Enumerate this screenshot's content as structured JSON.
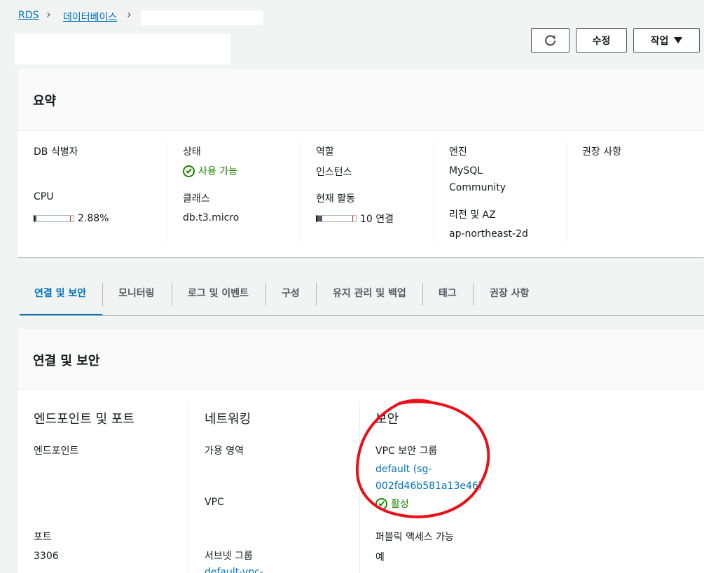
{
  "breadcrumb": {
    "rds": "RDS",
    "databases": "데이터베이스",
    "separator": "›"
  },
  "actions": {
    "refresh_icon": "refresh-icon",
    "modify": "수정",
    "actions": "작업",
    "dropdown_icon": "caret-down-icon"
  },
  "summary": {
    "title": "요약",
    "db_identifier_label": "DB 식별자",
    "cpu_label": "CPU",
    "cpu_value": "2.88%",
    "cpu_fraction": 0.0288,
    "status_label": "상태",
    "status_value": "사용 가능",
    "class_label": "클래스",
    "class_value": "db.t3.micro",
    "role_label": "역할",
    "role_value": "인스턴스",
    "activity_label": "현재 활동",
    "activity_value": "10 연결",
    "activity_fraction": 0.12,
    "engine_label": "엔진",
    "engine_value_line1": "MySQL",
    "engine_value_line2": "Community",
    "region_label": "리전 및 AZ",
    "region_value": "ap-northeast-2d",
    "recommendations_label": "권장 사항"
  },
  "tabs": [
    {
      "label": "연결 및 보안"
    },
    {
      "label": "모니터링"
    },
    {
      "label": "로그 및 이벤트"
    },
    {
      "label": "구성"
    },
    {
      "label": "유지 관리 및 백업"
    },
    {
      "label": "태그"
    },
    {
      "label": "권장 사항"
    }
  ],
  "connectivity": {
    "title": "연결 및 보안",
    "endpoint_section": "엔드포인트 및 포트",
    "endpoint_label": "엔드포인트",
    "port_label": "포트",
    "port_value": "3306",
    "network_section": "네트워킹",
    "az_label": "가용 영역",
    "vpc_label": "VPC",
    "subnet_label": "서브넷 그룹",
    "subnet_value": "default-vpc-",
    "security_section": "보안",
    "vpc_sg_label": "VPC 보안 그룹",
    "sg_link_line1": "default (sg-",
    "sg_link_line2": "002fd46b581a13e46)",
    "sg_status": "활성",
    "public_label": "퍼블릭 액세스 가능",
    "public_value": "예"
  },
  "colors": {
    "link": "#0073bb",
    "success": "#1d8102",
    "annotation": "#e8111b"
  }
}
